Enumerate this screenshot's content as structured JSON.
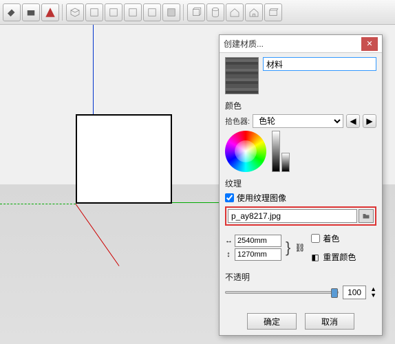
{
  "dialog": {
    "title": "创建材质...",
    "material_name": "材料",
    "sections": {
      "color": "颜色",
      "picker_label": "拾色器:",
      "picker_value": "色轮",
      "texture": "纹理",
      "use_texture": "使用纹理图像",
      "file_path": "p_ay8217.jpg",
      "width": "2540mm",
      "height": "1270mm",
      "tint": "着色",
      "reset_color": "重置颜色",
      "opacity": "不透明",
      "opacity_value": "100",
      "ok": "确定",
      "cancel": "取消"
    }
  },
  "toolbar_icons": [
    "paint-bucket",
    "print",
    "info",
    "layers",
    "plane1",
    "plane2",
    "plane3",
    "plane4",
    "plane5",
    "box",
    "cylinder",
    "house1",
    "house2",
    "box2"
  ]
}
